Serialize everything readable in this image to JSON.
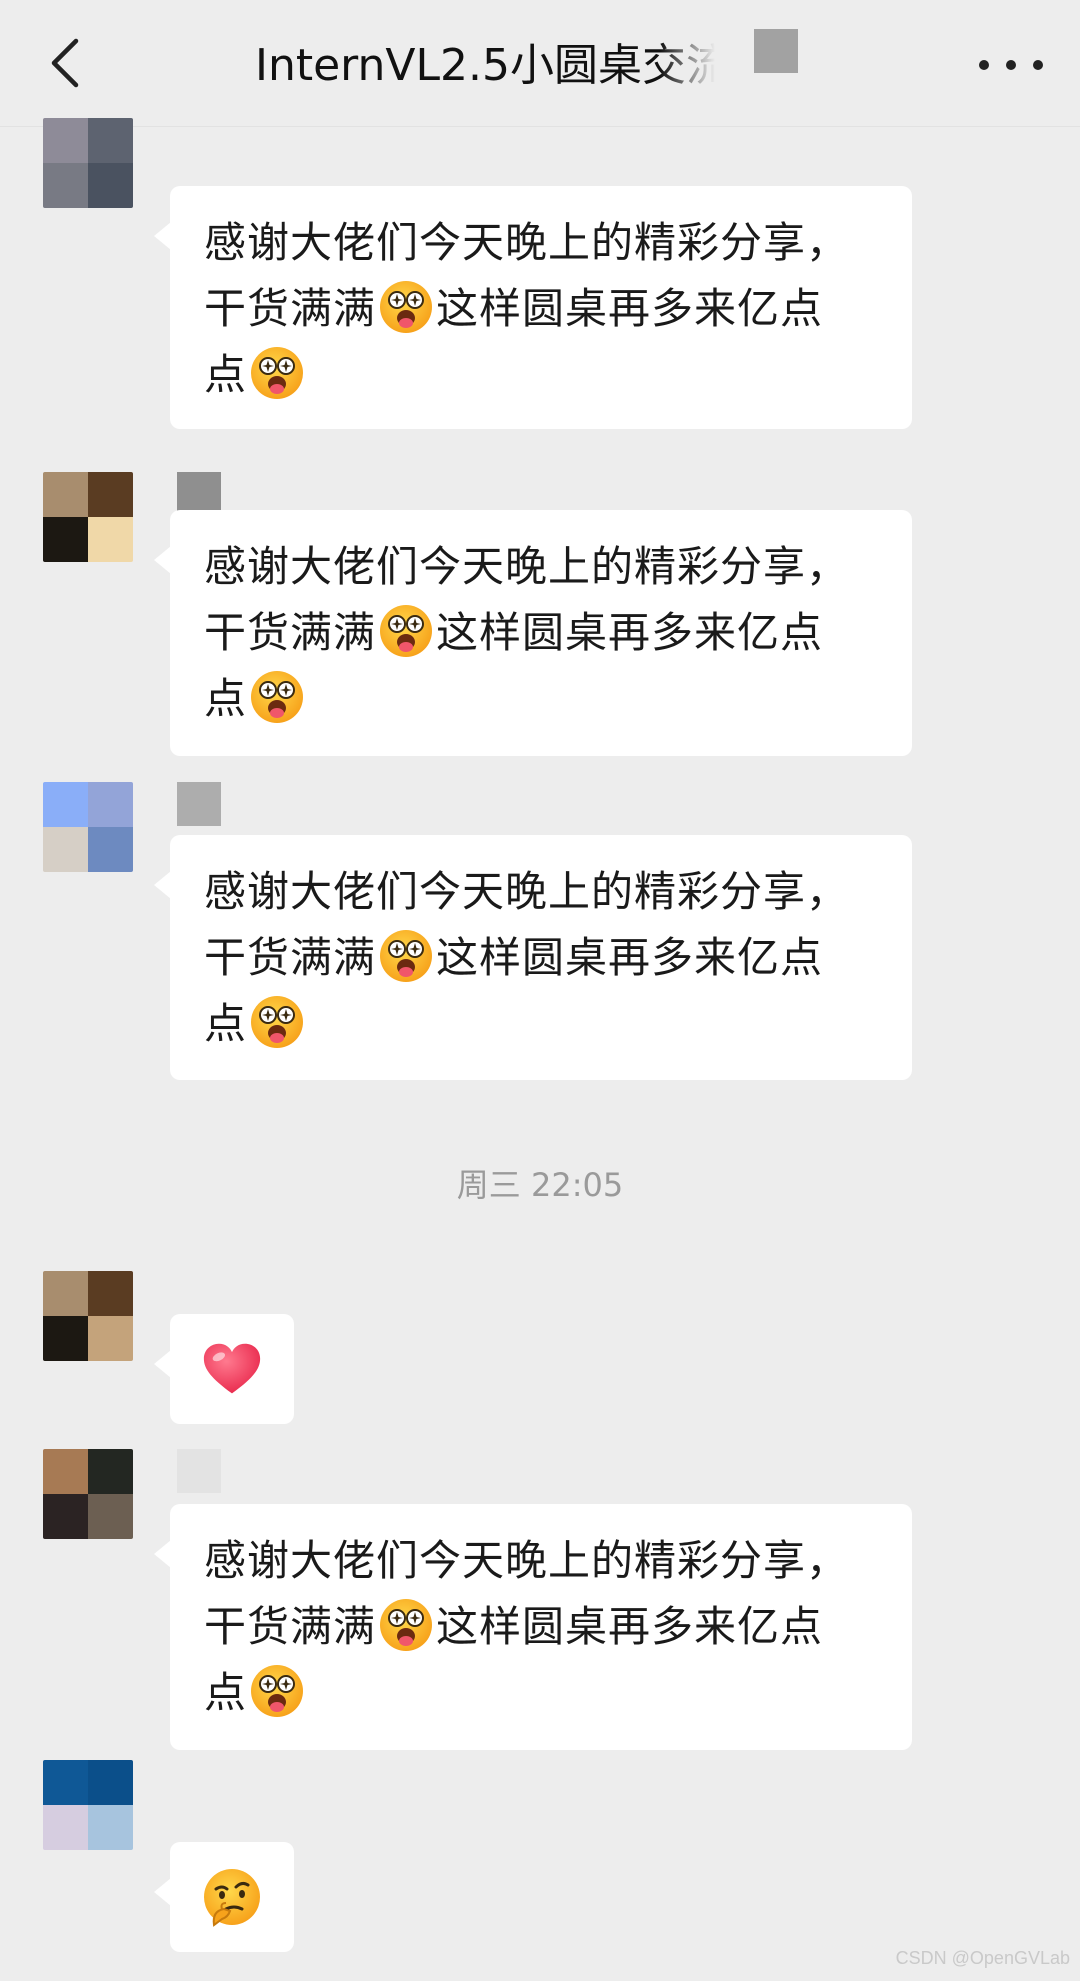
{
  "header": {
    "title": "InternVL2.5小圆桌交流",
    "back_icon": "chevron-left-icon",
    "more_icon": "more-dots-icon"
  },
  "messages": [
    {
      "type": "text",
      "line1": "感谢大佬们今天晚上的精彩分享，",
      "line2a": "干货满满",
      "line2b": "这样圆桌再多来亿点",
      "line3": "点",
      "emoji": "starstruck-tongue-emoji"
    },
    {
      "type": "text",
      "line1": "感谢大佬们今天晚上的精彩分享，",
      "line2a": "干货满满",
      "line2b": "这样圆桌再多来亿点",
      "line3": "点",
      "emoji": "starstruck-tongue-emoji"
    },
    {
      "type": "text",
      "line1": "感谢大佬们今天晚上的精彩分享，",
      "line2a": "干货满满",
      "line2b": "这样圆桌再多来亿点",
      "line3": "点",
      "emoji": "starstruck-tongue-emoji"
    },
    {
      "type": "sticker",
      "emoji": "red-heart-emoji"
    },
    {
      "type": "text",
      "line1": "感谢大佬们今天晚上的精彩分享，",
      "line2a": "干货满满",
      "line2b": "这样圆桌再多来亿点",
      "line3": "点",
      "emoji": "starstruck-tongue-emoji"
    },
    {
      "type": "sticker",
      "emoji": "thinking-face-emoji"
    }
  ],
  "time_divider": "周三 22:05",
  "watermark": "CSDN @OpenGVLab",
  "colors": {
    "background": "#ededed",
    "bubble": "#ffffff",
    "text": "#1a1a1a",
    "timestamp": "#9a9a9a"
  }
}
